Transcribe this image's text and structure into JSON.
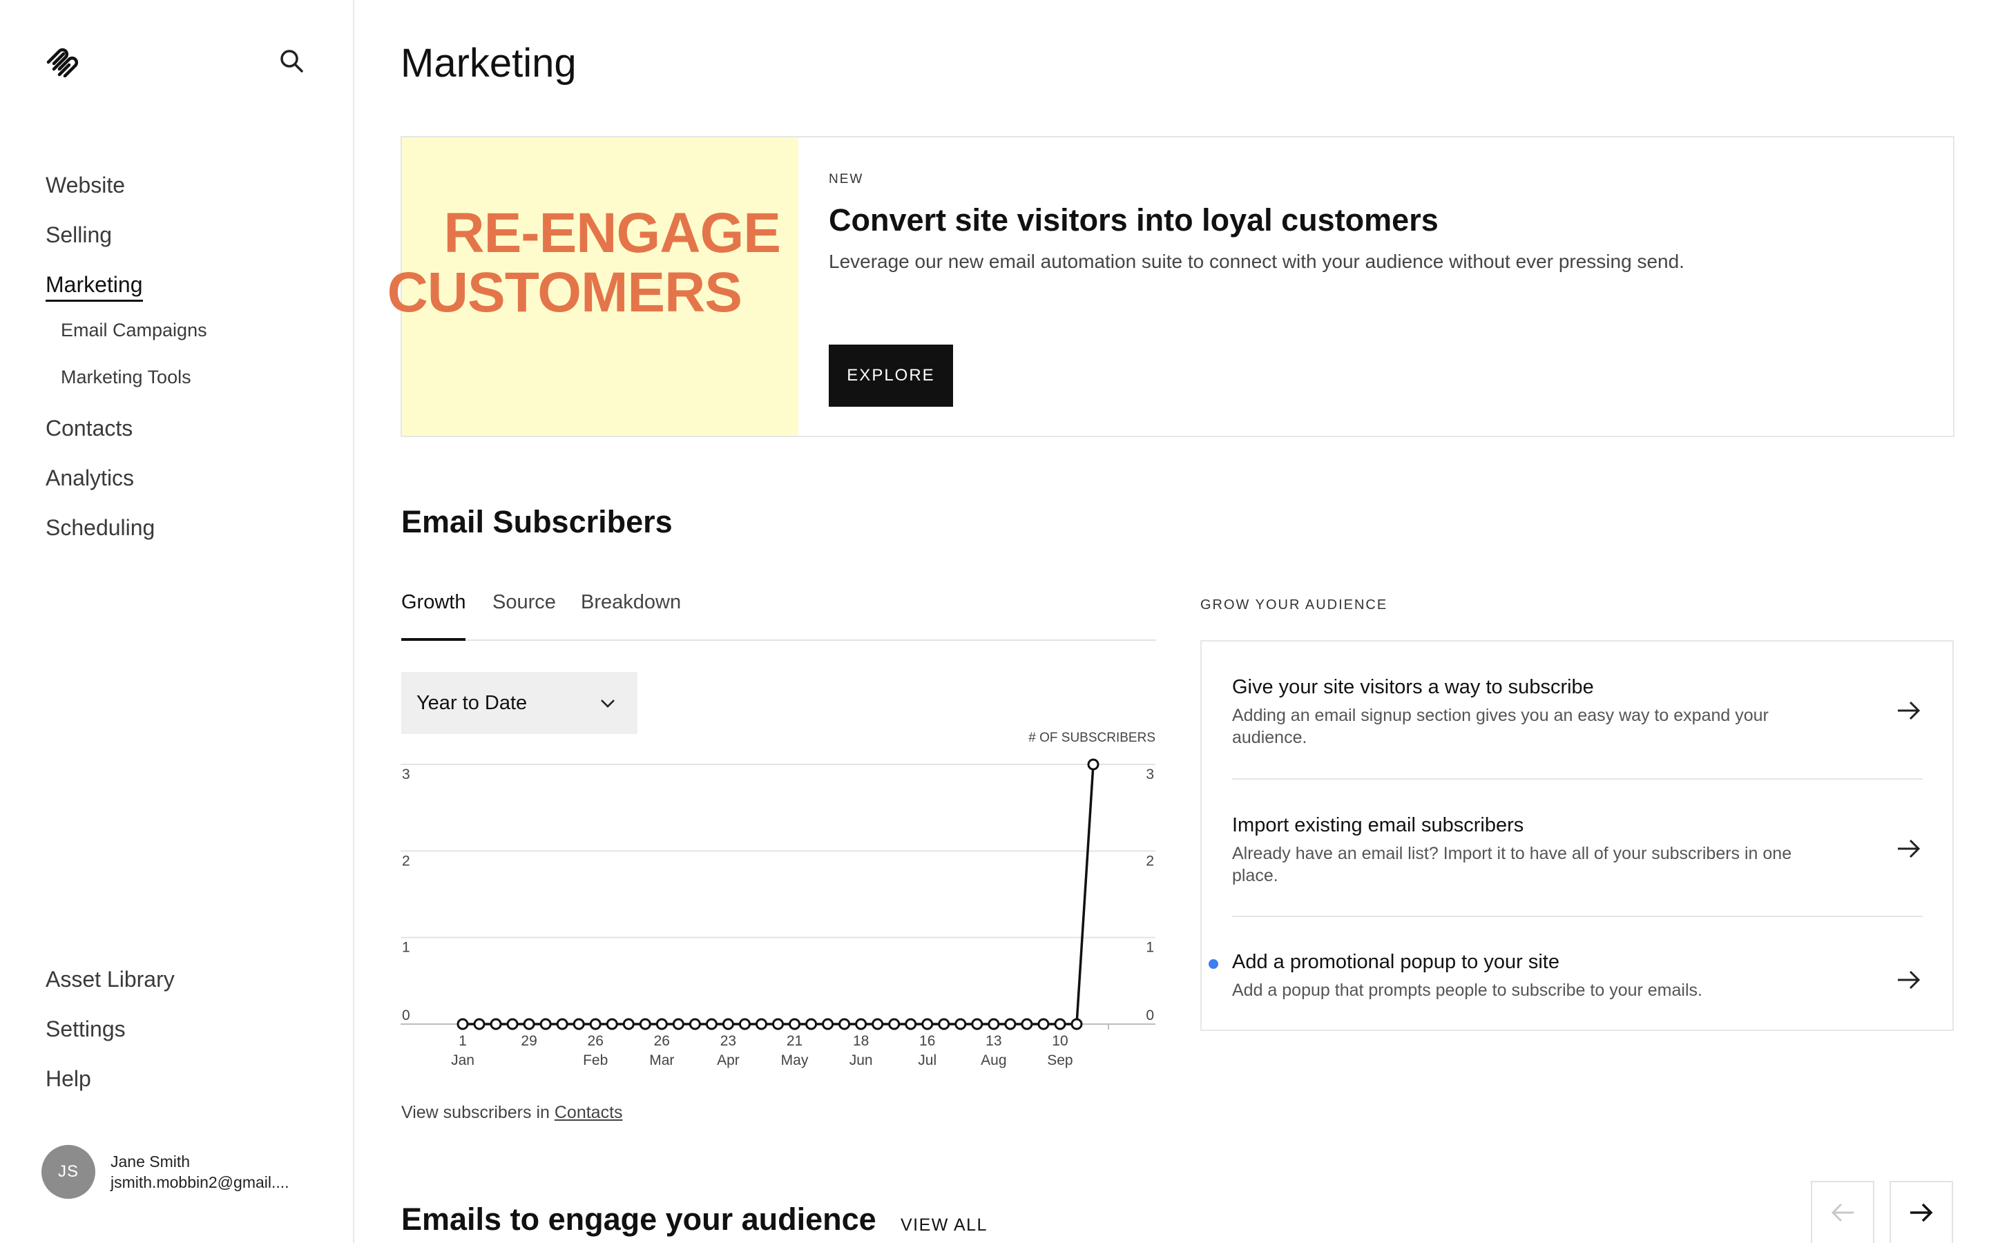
{
  "sidebar": {
    "logo_icon": "squarespace-logo-icon",
    "search_icon": "search-icon",
    "nav": [
      {
        "label": "Website"
      },
      {
        "label": "Selling"
      },
      {
        "label": "Marketing",
        "active": true
      },
      {
        "label": "Email Campaigns",
        "sub": true
      },
      {
        "label": "Marketing Tools",
        "sub": true
      },
      {
        "label": "Contacts"
      },
      {
        "label": "Analytics"
      },
      {
        "label": "Scheduling"
      }
    ],
    "bottom_nav": [
      {
        "label": "Asset Library"
      },
      {
        "label": "Settings"
      },
      {
        "label": "Help"
      }
    ],
    "user": {
      "initials": "JS",
      "name": "Jane Smith",
      "email": "jsmith.mobbin2@gmail...."
    }
  },
  "main": {
    "title": "Marketing",
    "promo": {
      "image_line1": "RE-ENGAGE",
      "image_line2": "CUSTOMERS",
      "tag": "NEW",
      "title": "Convert site visitors into loyal customers",
      "description": "Leverage our new email automation suite to connect with your audience without ever pressing send.",
      "button": "EXPLORE",
      "image_bg": "#fefccc",
      "image_text_color": "#e4754a"
    },
    "subscribers": {
      "title": "Email Subscribers",
      "tabs": [
        "Growth",
        "Source",
        "Breakdown"
      ],
      "active_tab": "Growth",
      "range": "Year to Date",
      "view_text": "View subscribers in ",
      "view_link": "Contacts"
    },
    "grow": {
      "label": "GROW YOUR AUDIENCE",
      "items": [
        {
          "title": "Give your site visitors a way to subscribe",
          "description": "Adding an email signup section gives you an easy way to expand your audience.",
          "icon": "arrow-right-icon"
        },
        {
          "title": "Import existing email subscribers",
          "description": "Already have an email list? Import it to have all of your subscribers in one place.",
          "icon": "arrow-right-icon"
        },
        {
          "title": "Add a promotional popup to your site",
          "description": "Add a popup that prompts people to subscribe to your emails.",
          "icon": "arrow-right-icon",
          "new_dot": true
        }
      ]
    },
    "engage": {
      "title": "Emails to engage your audience",
      "view_all": "VIEW ALL",
      "prev_icon": "arrow-left-icon",
      "next_icon": "arrow-right-icon"
    }
  },
  "chart_data": {
    "type": "line",
    "ylabel": "# OF SUBSCRIBERS",
    "ylim": [
      0,
      3
    ],
    "yticks": [
      0,
      1,
      2,
      3
    ],
    "x_tick_labels": [
      {
        "day": "1",
        "month": "Jan"
      },
      {
        "day": "29",
        "month": ""
      },
      {
        "day": "26",
        "month": "Feb"
      },
      {
        "day": "26",
        "month": "Mar"
      },
      {
        "day": "23",
        "month": "Apr"
      },
      {
        "day": "21",
        "month": "May"
      },
      {
        "day": "18",
        "month": "Jun"
      },
      {
        "day": "16",
        "month": "Jul"
      },
      {
        "day": "13",
        "month": "Aug"
      },
      {
        "day": "10",
        "month": "Sep"
      }
    ],
    "series": [
      {
        "values": [
          0,
          0,
          0,
          0,
          0,
          0,
          0,
          0,
          0,
          0,
          0,
          0,
          0,
          0,
          0,
          0,
          0,
          0,
          0,
          0,
          0,
          0,
          0,
          0,
          0,
          0,
          0,
          0,
          0,
          0,
          0,
          0,
          0,
          0,
          0,
          0,
          0,
          0,
          3
        ]
      }
    ],
    "grid": true,
    "line_color": "#111111"
  }
}
